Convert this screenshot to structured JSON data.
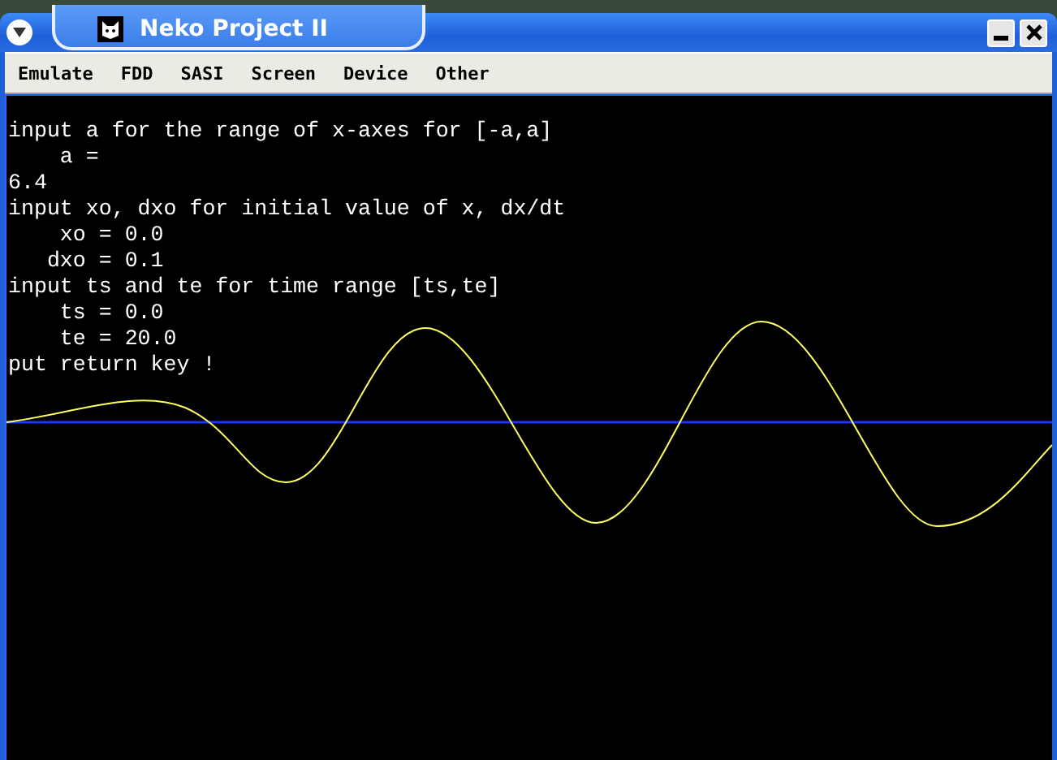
{
  "window": {
    "title": "Neko Project II"
  },
  "menu": [
    "Emulate",
    "FDD",
    "SASI",
    "Screen",
    "Device",
    "Other"
  ],
  "console": {
    "lines": [
      "input a for the range of x-axes for [-a,a]",
      "    a =",
      "6.4",
      "input xo, dxo for initial value of x, dx/dt",
      "    xo = 0.0",
      "   dxo = 0.1",
      "input ts and te for time range [ts,te]",
      "    ts = 0.0",
      "    te = 20.0",
      "put return key !"
    ]
  }
}
